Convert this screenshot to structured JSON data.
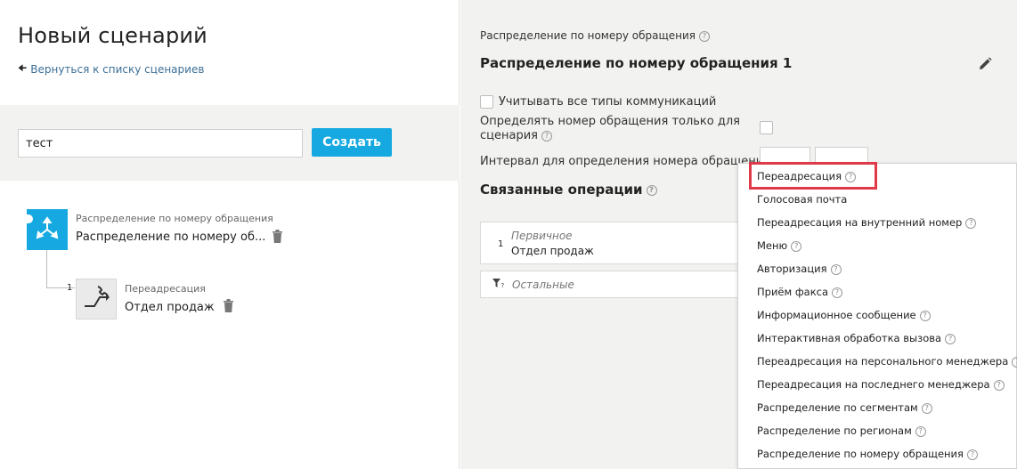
{
  "page": {
    "title": "Новый сценарий",
    "back_link": "Вернуться к списку сценариев"
  },
  "search": {
    "value": "тест",
    "create_label": "Создать"
  },
  "tree": {
    "root": {
      "type": "Распределение по номеру обращения",
      "name": "Распределение по номеру об..."
    },
    "child": {
      "number": "1",
      "type": "Переадресация",
      "name": "Отдел продаж"
    }
  },
  "panel": {
    "type_label": "Распределение по номеру обращения",
    "title": "Распределение по номеру обращения 1",
    "all_types_label": "Учитывать все типы коммуникаций",
    "only_scenario_label_1": "Определять номер обращения только для",
    "only_scenario_label_2": "сценария",
    "interval_label": "Интервал для определения номера обращения",
    "linked_ops_title": "Связанные операции",
    "op_number": "1",
    "op_sub": "Первичное",
    "op_main": "Отдел продаж",
    "op_other": "Остальные"
  },
  "dropdown": {
    "items": [
      "Переадресация",
      "Голосовая почта",
      "Переадресация на внутренний номер",
      "Меню",
      "Авторизация",
      "Приём факса",
      "Информационное сообщение",
      "Интерактивная обработка вызова",
      "Переадресация на персонального менеджера",
      "Переадресация на последнего менеджера",
      "Распределение по сегментам",
      "Распределение по регионам",
      "Распределение по номеру обращения"
    ],
    "highlighted": "Переадресация"
  },
  "colors": {
    "accent": "#16a9e1",
    "highlight_border": "#e03a4a",
    "link": "#3b6f97"
  }
}
